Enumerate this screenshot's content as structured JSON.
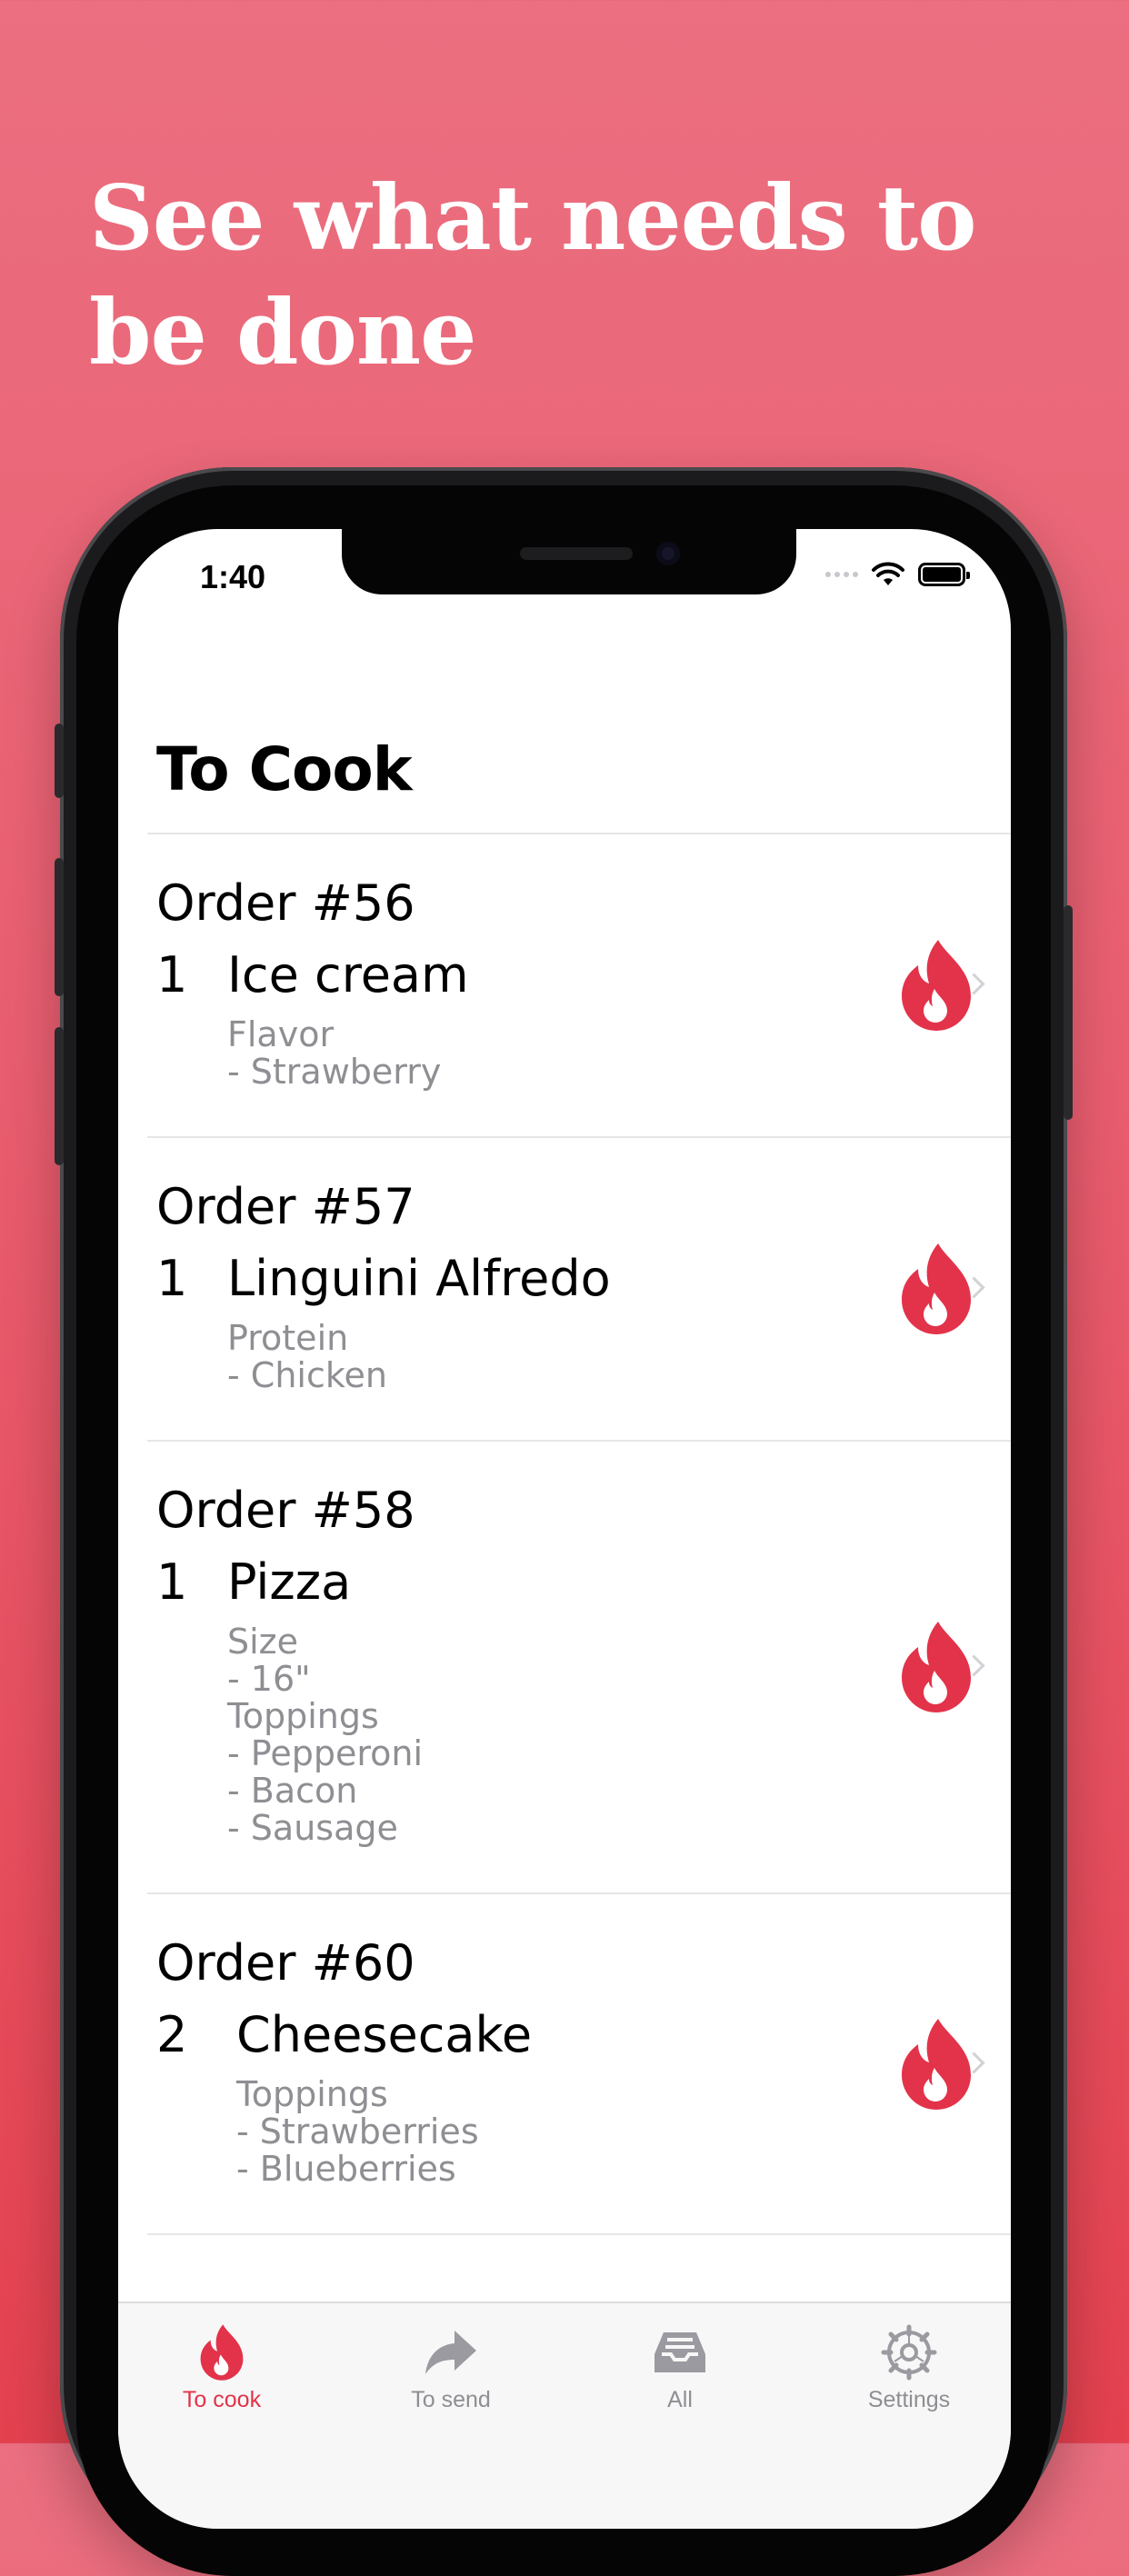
{
  "headline": "See what needs to be done",
  "status_bar": {
    "time": "1:40"
  },
  "page_title": "To Cook",
  "accent_color": "#e2334a",
  "orders": [
    {
      "number": "Order #56",
      "qty": "1",
      "item": "Ice cream",
      "mods": [
        "Flavor",
        "- Strawberry"
      ]
    },
    {
      "number": "Order #57",
      "qty": "1",
      "item": "Linguini Alfredo",
      "mods": [
        "Protein",
        "- Chicken"
      ]
    },
    {
      "number": "Order #58",
      "qty": "1",
      "item": "Pizza",
      "mods": [
        "Size",
        "- 16\"",
        "Toppings",
        "- Pepperoni",
        "- Bacon",
        "- Sausage"
      ]
    },
    {
      "number": "Order #60",
      "qty": "2",
      "item": "Cheesecake",
      "mods": [
        "Toppings",
        "- Strawberries",
        "- Blueberries"
      ]
    }
  ],
  "tabs": [
    {
      "label": "To cook",
      "icon": "flame-icon",
      "active": true
    },
    {
      "label": "To send",
      "icon": "share-arrow-icon",
      "active": false
    },
    {
      "label": "All",
      "icon": "inbox-tray-icon",
      "active": false
    },
    {
      "label": "Settings",
      "icon": "gear-icon",
      "active": false
    }
  ]
}
